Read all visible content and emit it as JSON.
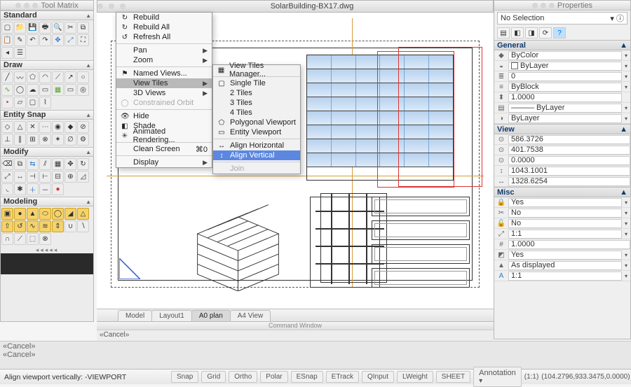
{
  "doc": {
    "title": "SolarBuilding-BX17.dwg"
  },
  "palettes": {
    "tool_matrix_title": "Tool Matrix",
    "sections": {
      "standard": "Standard",
      "draw": "Draw",
      "entity_snap": "Entity Snap",
      "modify": "Modify",
      "modeling": "Modeling"
    }
  },
  "menu1": {
    "items": [
      {
        "label": "Rebuild",
        "icon": "↻"
      },
      {
        "label": "Rebuild All",
        "icon": "↻"
      },
      {
        "label": "Refresh All",
        "icon": "↺"
      }
    ],
    "nav": [
      {
        "label": "Pan",
        "arrow": true
      },
      {
        "label": "Zoom",
        "arrow": true
      }
    ],
    "views": [
      {
        "label": "Named Views...",
        "icon": "⚑"
      },
      {
        "label": "View Tiles",
        "arrow": true,
        "selected": true
      },
      {
        "label": "3D Views",
        "arrow": true
      },
      {
        "label": "Constrained Orbit",
        "icon": "◯",
        "disabled": true
      }
    ],
    "visual": [
      {
        "label": "Hide",
        "icon": "👁"
      },
      {
        "label": "Shade",
        "icon": "◧"
      },
      {
        "label": "Animated Rendering...",
        "icon": "✳"
      }
    ],
    "screen_item": {
      "label": "Clean Screen",
      "accel": "⌘0"
    },
    "display": {
      "label": "Display",
      "arrow": true
    }
  },
  "menu2": {
    "manager": "View Tiles Manager...",
    "tiles": [
      "Single Tile",
      "2 Tiles",
      "3 Tiles",
      "4 Tiles"
    ],
    "viewports": [
      "Polygonal Viewport",
      "Entity Viewport"
    ],
    "align": [
      "Align Horizontal",
      "Align Vertical"
    ],
    "join": "Join"
  },
  "sheets": [
    "Model",
    "Layout1",
    "A0 plan",
    "A4 View"
  ],
  "active_sheet": 2,
  "cmd_window": {
    "title": "Command Window",
    "line": "«Cancel»"
  },
  "status": {
    "prompt": "Align viewport vertically: -VIEWPORT",
    "buttons": [
      "Snap",
      "Grid",
      "Ortho",
      "Polar",
      "ESnap",
      "ETrack",
      "QInput",
      "LWeight",
      "SHEET",
      "Annotation"
    ],
    "scale": "(1:1)",
    "coords": "(104.2796,933.3475,0.0000)"
  },
  "properties": {
    "title": "Properties",
    "selection": "No Selection",
    "sections": {
      "general": "General",
      "view": "View",
      "misc": "Misc"
    },
    "general": {
      "color": "ByColor",
      "layer": "ByLayer",
      "linetype_layer": "0",
      "lineweight": "ByBlock",
      "thickness": "1.0000",
      "plot_style": "——— ByLayer",
      "material": "ByLayer"
    },
    "view": {
      "center_x": "586.3726",
      "center_y": "401.7538",
      "center_z": "0.0000",
      "height": "1043.1001",
      "width": "1328.6254"
    },
    "misc": {
      "locked": "Yes",
      "clipped": "No",
      "display_locked": "No",
      "scale1": "1:1",
      "custom_scale": "1.0000",
      "ucs_per": "Yes",
      "shade_plot": "As displayed",
      "anno_scale": "1:1"
    }
  }
}
